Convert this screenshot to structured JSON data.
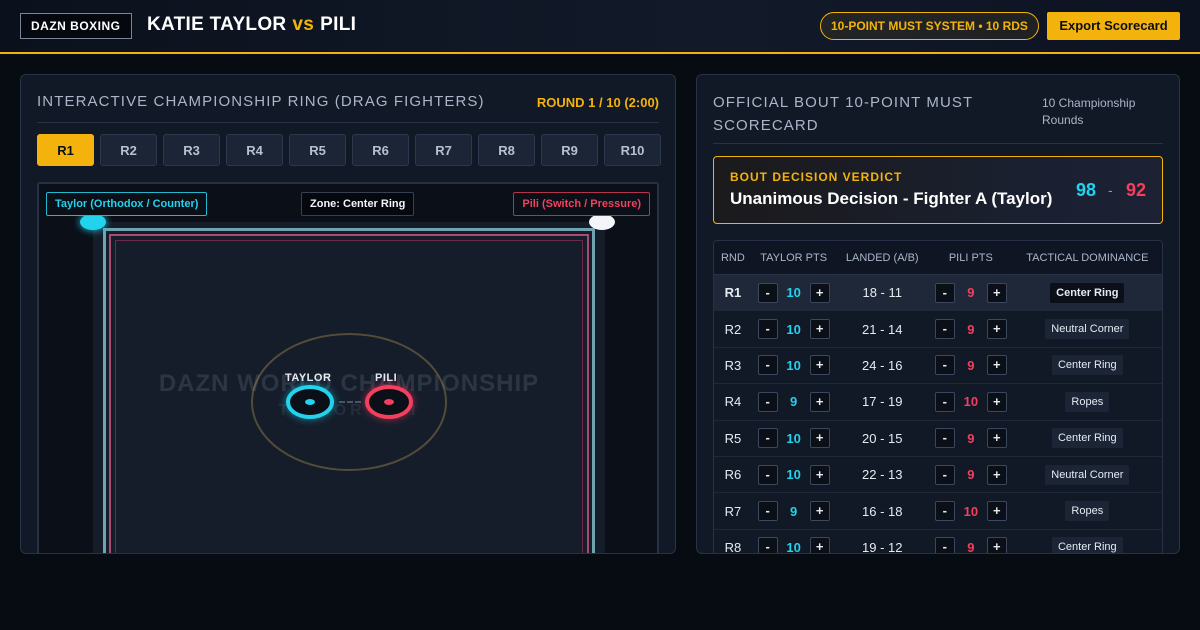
{
  "header": {
    "brand": "DAZN BOXING",
    "fighter_a": "KATIE TAYLOR",
    "vs": "vs",
    "fighter_b": "PILI",
    "system_badge": "10-POINT MUST SYSTEM • 10 RDS",
    "export_label": "Export Scorecard"
  },
  "ring_panel": {
    "title": "INTERACTIVE CHAMPIONSHIP RING (DRAG FIGHTERS)",
    "round_indicator": "ROUND 1 / 10 (2:00)",
    "active_round": "R1",
    "rounds": [
      "R1",
      "R2",
      "R3",
      "R4",
      "R5",
      "R6",
      "R7",
      "R8",
      "R9",
      "R10"
    ],
    "chip_taylor": "Taylor (Orthodox / Counter)",
    "chip_zone": "Zone: Center Ring",
    "chip_pili": "Pili (Switch / Pressure)",
    "watermark": "DAZN WORLD CHAMPIONSHIP",
    "watermark_sub": "TAYLOR PILI",
    "fighter_a_label": "TAYLOR",
    "fighter_b_label": "PILI"
  },
  "score_panel": {
    "title": "OFFICIAL BOUT 10-POINT MUST SCORECARD",
    "rounds_note": "10 Championship Rounds",
    "verdict_label": "BOUT DECISION VERDICT",
    "verdict_text": "Unanimous Decision - Fighter A (Taylor)",
    "total_a": "98",
    "total_sep": "-",
    "total_b": "92"
  },
  "table": {
    "headers": {
      "rnd": "RND",
      "a": "TAYLOR PTS",
      "landed": "LANDED (A/B)",
      "b": "PILI PTS",
      "tactical": "TACTICAL DOMINANCE"
    },
    "minus": "-",
    "plus": "+",
    "rows": [
      {
        "rnd": "R1",
        "a": "10",
        "landed": "18 - 11",
        "b": "9",
        "tactical": "Center Ring"
      },
      {
        "rnd": "R2",
        "a": "10",
        "landed": "21 - 14",
        "b": "9",
        "tactical": "Neutral Corner"
      },
      {
        "rnd": "R3",
        "a": "10",
        "landed": "24 - 16",
        "b": "9",
        "tactical": "Center Ring"
      },
      {
        "rnd": "R4",
        "a": "9",
        "landed": "17 - 19",
        "b": "10",
        "tactical": "Ropes"
      },
      {
        "rnd": "R5",
        "a": "10",
        "landed": "20 - 15",
        "b": "9",
        "tactical": "Center Ring"
      },
      {
        "rnd": "R6",
        "a": "10",
        "landed": "22 - 13",
        "b": "9",
        "tactical": "Neutral Corner"
      },
      {
        "rnd": "R7",
        "a": "9",
        "landed": "16 - 18",
        "b": "10",
        "tactical": "Ropes"
      },
      {
        "rnd": "R8",
        "a": "10",
        "landed": "19 - 12",
        "b": "9",
        "tactical": "Center Ring"
      }
    ]
  },
  "colors": {
    "accent": "#f4b30c",
    "fighter_a": "#22d3ee",
    "fighter_b": "#f43f5e"
  }
}
